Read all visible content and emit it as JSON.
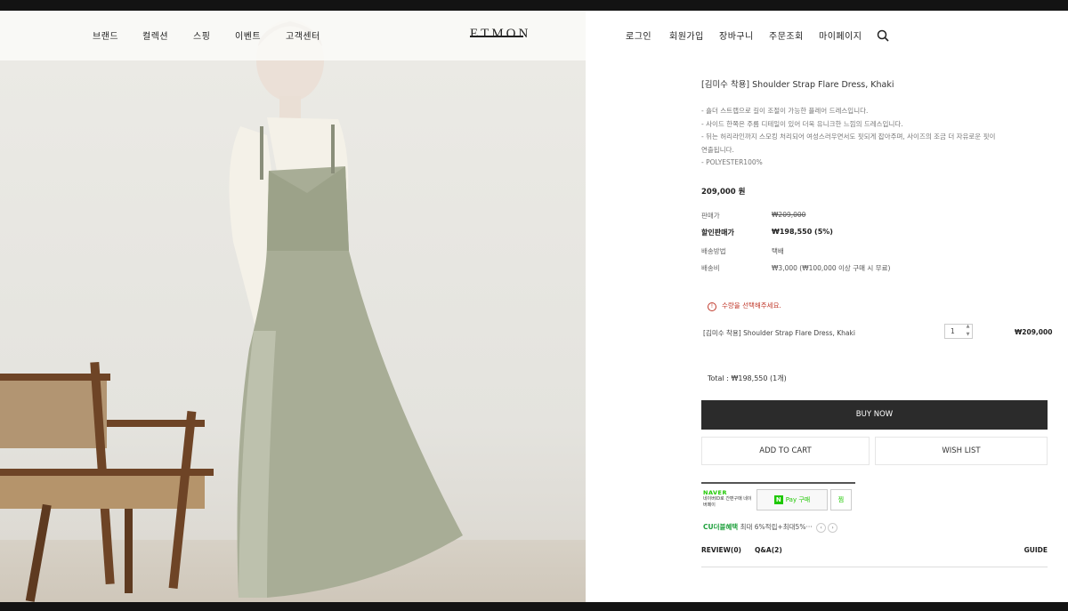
{
  "header": {
    "nav_left": [
      "브랜드",
      "컬렉션",
      "스핑",
      "이벤트",
      "고객센터"
    ],
    "logo": "ETMON",
    "nav_right": [
      "로그인",
      "회원가입",
      "장바구니",
      "주문조회",
      "마이페이지"
    ]
  },
  "product": {
    "title": "[김미수 착용] Shoulder Strap Flare Dress, Khaki",
    "description": [
      "- 숄더 스트랩으로 길이 조절이 가능한 플레어 드레스입니다.",
      "- 사이드 한쪽은 주름 디테일이 있어 더욱 유니크한 느낌의 드레스입니다.",
      "- 뒤는 허리라인까지 스모킹 처리되어 여성스러우면서도 핏되게 잡아주며, 사이즈의 조금 더 자유로운 핏이",
      "연출됩니다.",
      "- POLYESTER100%"
    ],
    "price": "209,000 원",
    "rows": [
      {
        "label": "판매가",
        "value": "₩209,000"
      },
      {
        "label": "할인판매가",
        "value": "₩198,550 (5%)"
      },
      {
        "label": "배송방법",
        "value": "택배"
      },
      {
        "label": "배송비",
        "value": "₩3,000 (₩100,000 이상 구매 시 무료)"
      }
    ],
    "notice": "수량을 선택해주세요.",
    "selected": {
      "name": "[김미수 착용] Shoulder Strap Flare Dress, Khaki",
      "qty": "1",
      "price": "₩209,000"
    },
    "total": "Total : ₩198,550 (1개)"
  },
  "buttons": {
    "buy": "BUY NOW",
    "cart": "ADD TO CART",
    "wish": "WISH LIST"
  },
  "npay": {
    "logo": "NAVER",
    "sub": "네이버ID로 간편구매 네이버페이",
    "pay_label": "Pay 구매",
    "zzim": "찜"
  },
  "cu": {
    "strong": "CU더블혜택",
    "text": "최대 6%적립+최대5%···"
  },
  "tabs": {
    "review": "REVIEW(0)",
    "qa": "Q&A(2)",
    "guide": "GUIDE"
  },
  "colors": {
    "button_dark": "#2b2b2b",
    "npay_green": "#1ec800",
    "notice_red": "#c0392b"
  }
}
